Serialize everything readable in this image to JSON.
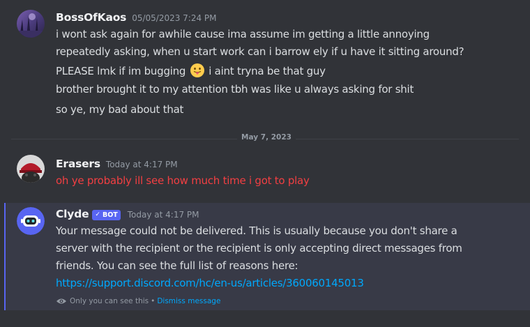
{
  "messages": [
    {
      "username": "BossOfKaos",
      "timestamp": "05/05/2023 7:24 PM",
      "lines": [
        "i wont ask again for awhile cause ima assume im getting a little annoying",
        "repeatedly asking, when u start work can i barrow ely if u have it sitting around?",
        "PLEASE lmk if im bugging",
        "i aint tryna be that guy",
        "brother brought it to my attention tbh was like u always asking for shit",
        "so ye, my bad about that"
      ],
      "emoji": "tongue-out-emoji"
    },
    {
      "username": "Erasers",
      "timestamp": "Today at 4:17 PM",
      "lines": [
        "oh ye probably ill see how much time i got to play"
      ],
      "text_color": "#f23f42"
    },
    {
      "username": "Clyde",
      "bot_tag": "BOT",
      "timestamp": "Today at 4:17 PM",
      "lines": [
        "Your message could not be delivered. This is usually because you don't share a",
        "server with the recipient or the recipient is only accepting direct messages from",
        "friends. You can see the full list of reasons here:",
        "https://support.discord.com/hc/en-us/articles/360060145013"
      ],
      "ephemeral_note": "Only you can see this",
      "separator": "•",
      "dismiss_label": "Dismiss message"
    }
  ],
  "date_divider": "May 7, 2023",
  "colors": {
    "background": "#313338",
    "accent": "#5865f2",
    "link": "#00a8fc",
    "username": "#f2f3f5",
    "timestamp": "#949ba4",
    "text": "#dbdee1",
    "ephemeral_bg": "#383a47"
  }
}
